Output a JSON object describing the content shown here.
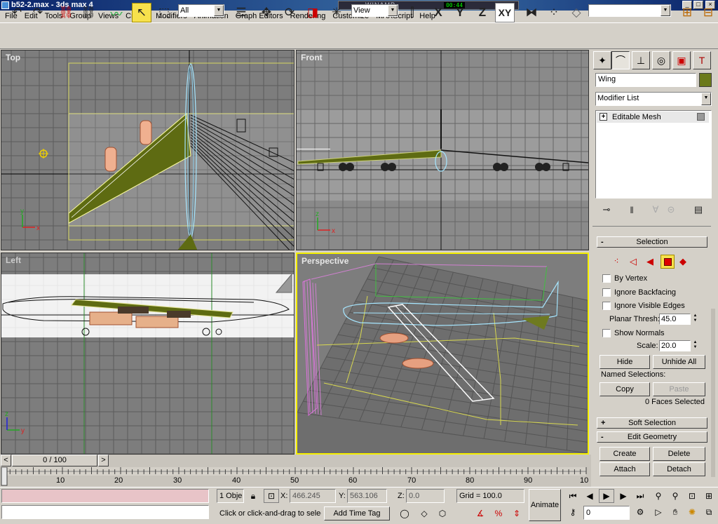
{
  "window": {
    "title": "b52-2.max - 3ds max 4",
    "controls": [
      "_",
      "□",
      "×"
    ]
  },
  "winamp": {
    "title": "WINAMP",
    "time": "00:44"
  },
  "menubar": [
    "File",
    "Edit",
    "Tools",
    "Group",
    "Views",
    "Create",
    "Modifiers",
    "Animation",
    "Graph Editors",
    "Rendering",
    "Customize",
    "MAXScript",
    "Help"
  ],
  "toolbar": {
    "undo_icon": "undo-icon",
    "redo_icon": "redo-icon",
    "selection_filter": "All",
    "ref_coord": "View",
    "axes": [
      "X",
      "Y",
      "Z",
      "XY"
    ],
    "active_axis": "XY",
    "named_selection": ""
  },
  "viewports": {
    "top": {
      "label": "Top"
    },
    "front": {
      "label": "Front"
    },
    "left": {
      "label": "Left"
    },
    "perspective": {
      "label": "Perspective"
    }
  },
  "axis_letters": {
    "x": "x",
    "y": "y",
    "z": "z"
  },
  "command_panel": {
    "tabs": [
      "create-icon",
      "modify-icon",
      "hierarchy-icon",
      "motion-icon",
      "display-icon",
      "utilities-icon"
    ],
    "active_tab": "modify-icon",
    "object_name": "Wing",
    "object_color": "#6b7a1a",
    "modifier_list": "Modifier List",
    "stack": [
      {
        "label": "Editable Mesh",
        "expand": "+"
      }
    ],
    "selection": {
      "title": "Selection",
      "levels": [
        "vertex-icon",
        "edge-icon",
        "face-icon",
        "polygon-icon",
        "element-icon"
      ],
      "active_level": "polygon-icon",
      "by_vertex": "By Vertex",
      "ignore_backfacing": "Ignore Backfacing",
      "ignore_visible_edges": "Ignore Visible Edges",
      "planar_thresh_label": "Planar Thresh:",
      "planar_thresh": "45.0",
      "show_normals": "Show Normals",
      "scale_label": "Scale:",
      "scale": "20.0",
      "hide": "Hide",
      "unhide_all": "Unhide All",
      "named_selections": "Named Selections:",
      "copy": "Copy",
      "paste": "Paste",
      "status": "0 Faces Selected"
    },
    "soft_selection": {
      "title": "Soft Selection",
      "sign": "+"
    },
    "edit_geometry": {
      "title": "Edit Geometry",
      "sign": "-",
      "create": "Create",
      "delete": "Delete",
      "attach": "Attach",
      "detach": "Detach"
    },
    "selection_sign": "-"
  },
  "timeline": {
    "slider": "0 / 100",
    "prev": "<",
    "next": ">",
    "ticks": [
      "10",
      "20",
      "30",
      "40",
      "50",
      "60",
      "70",
      "80",
      "90",
      "10"
    ]
  },
  "status": {
    "selected": "1 Obje",
    "x_label": "X:",
    "x": "466.245",
    "y_label": "Y:",
    "y": "563.106",
    "z_label": "Z:",
    "z": "0.0",
    "grid": "Grid = 100.0",
    "prompt": "Click or click-and-drag to selec",
    "add_time_tag": "Add Time Tag",
    "animate": "Animate",
    "frame": "0"
  }
}
